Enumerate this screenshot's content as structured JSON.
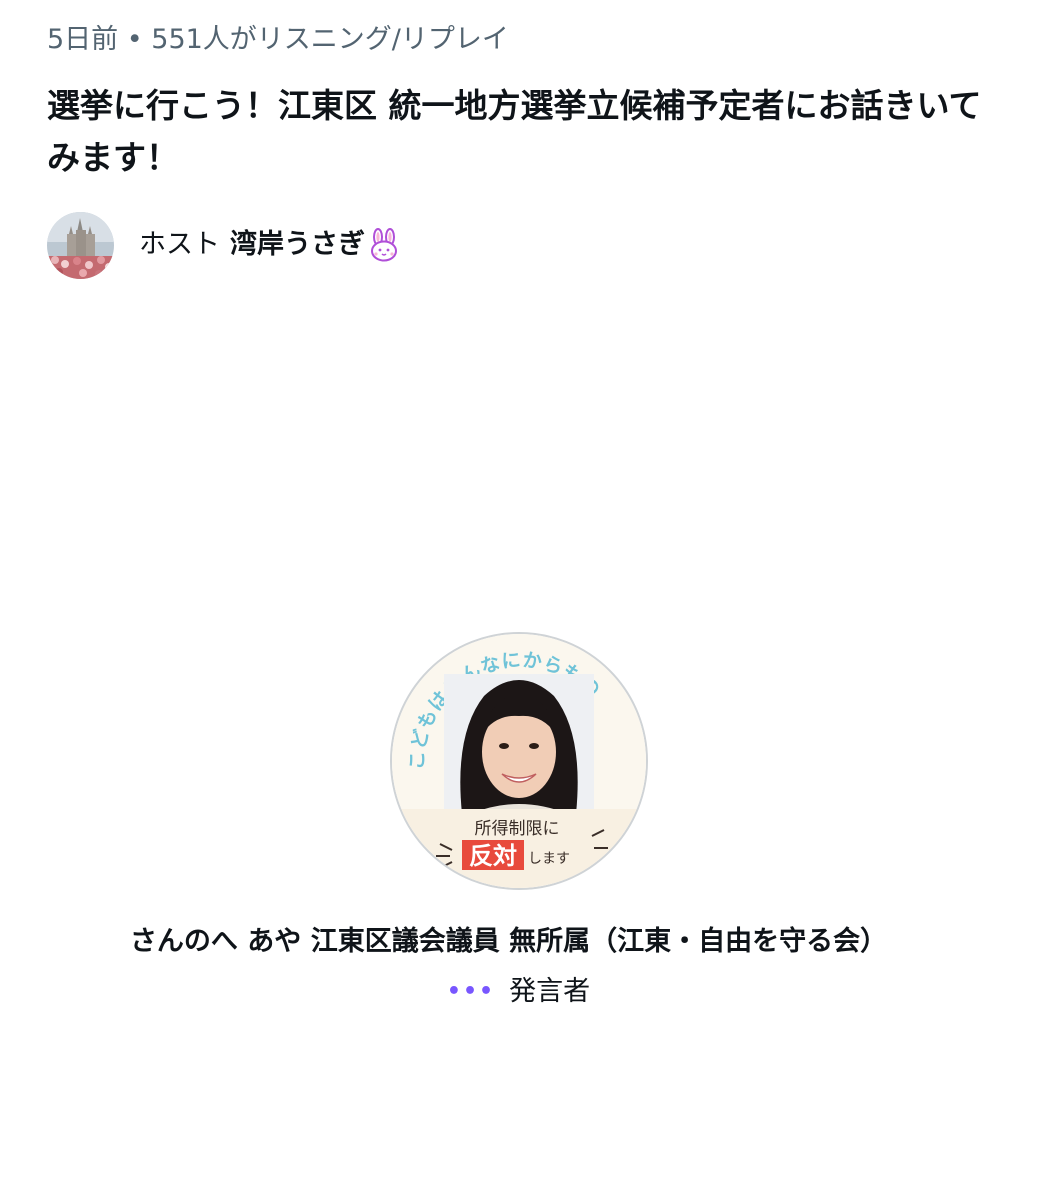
{
  "space": {
    "meta": "5日前 • 551人がリスニング/リプレイ",
    "title": "選挙に行こう！江東区 統一地方選挙立候補予定者にお話きいてみます！"
  },
  "host": {
    "label": "ホスト",
    "name": "湾岸うさぎ",
    "avatar_icon": "castle-photo",
    "badge_icon": "rabbit-face-icon"
  },
  "speaker": {
    "name": "さんのへ あや 江東区議会議員 無所属（江東・自由を守る会）",
    "role": "発言者",
    "role_icon": "dots-icon",
    "avatar_icon": "profile-photo",
    "avatar_text": {
      "ring": "こどもはみんなにからもの",
      "line1": "所得制限に",
      "line2_highlight": "反対",
      "line2_rest": "します"
    }
  },
  "colors": {
    "secondary_text": "#536471",
    "primary_text": "#0f1419",
    "accent": "#7856ff"
  }
}
